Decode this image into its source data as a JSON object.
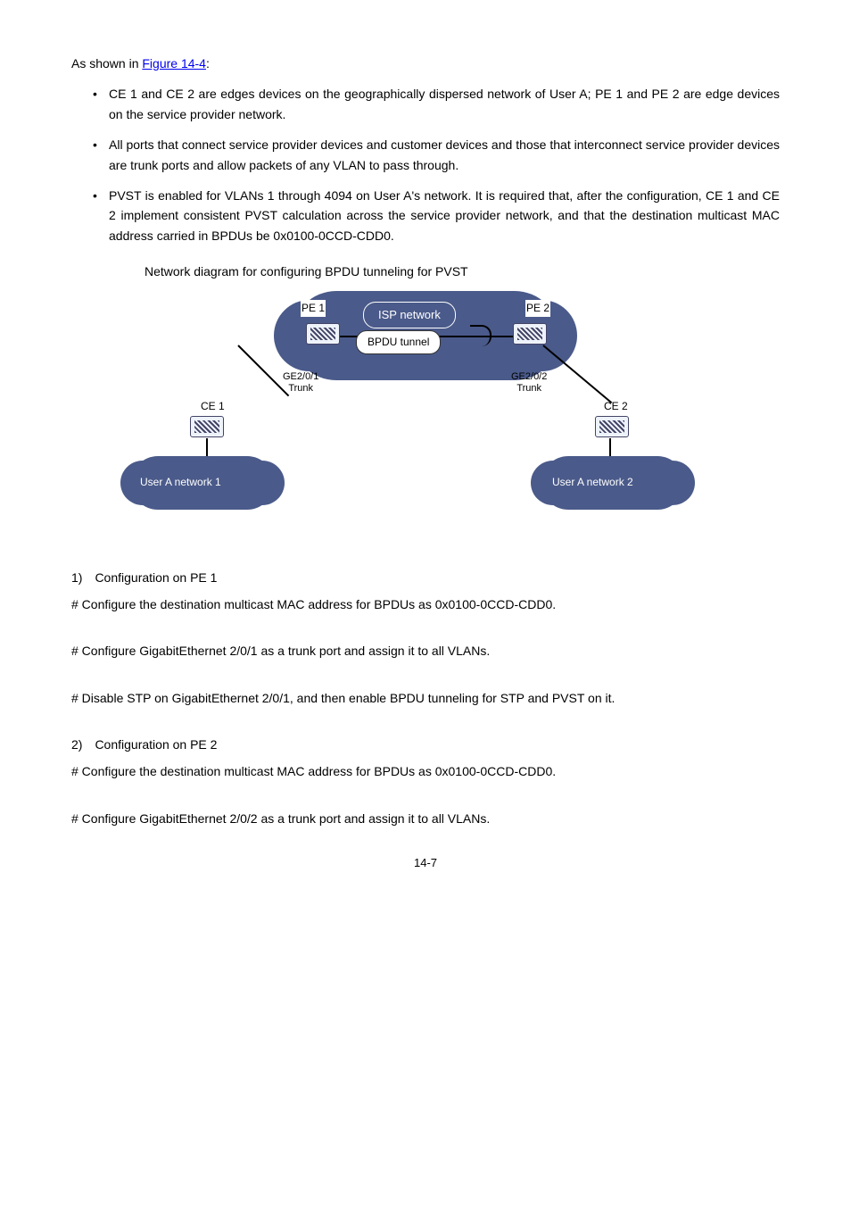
{
  "intro": {
    "prefix": "As shown in ",
    "link": "Figure 14-4",
    "suffix": ":"
  },
  "bullets": [
    "CE 1 and CE 2 are edges devices on the geographically dispersed network of User A; PE 1 and PE 2 are edge devices on the service provider network.",
    "All ports that connect service provider devices and customer devices and those that interconnect service provider devices are trunk ports and allow packets of any VLAN to pass through.",
    "PVST is enabled for VLANs 1 through 4094 on User A's network. It is required that, after the configuration, CE 1 and CE 2 implement consistent PVST calculation across the service provider network, and that the destination multicast MAC address carried in BPDUs be 0x0100-0CCD-CDD0."
  ],
  "figure_caption": "Network diagram for configuring BPDU tunneling for PVST",
  "diagram": {
    "isp": "ISP network",
    "tunnel": "BPDU tunnel",
    "pe1": "PE 1",
    "pe2": "PE 2",
    "ge1_line1": "GE2/0/1",
    "ge1_line2": "Trunk",
    "ge2_line1": "GE2/0/2",
    "ge2_line2": "Trunk",
    "ce1": "CE 1",
    "ce2": "CE 2",
    "ua1": "User A network 1",
    "ua2": "User A network 2"
  },
  "steps": {
    "s1_h": "1) Configuration on PE 1",
    "s1_a": "# Configure the destination multicast MAC address for BPDUs as 0x0100-0CCD-CDD0.",
    "s1_b": "# Configure GigabitEthernet 2/0/1 as a trunk port and assign it to all VLANs.",
    "s1_c": "# Disable STP on GigabitEthernet 2/0/1, and then enable BPDU tunneling for STP and PVST on it.",
    "s2_h": "2) Configuration on PE 2",
    "s2_a": "# Configure the destination multicast MAC address for BPDUs as 0x0100-0CCD-CDD0.",
    "s2_b": "# Configure GigabitEthernet 2/0/2 as a trunk port and assign it to all VLANs."
  },
  "page_number": "14-7"
}
